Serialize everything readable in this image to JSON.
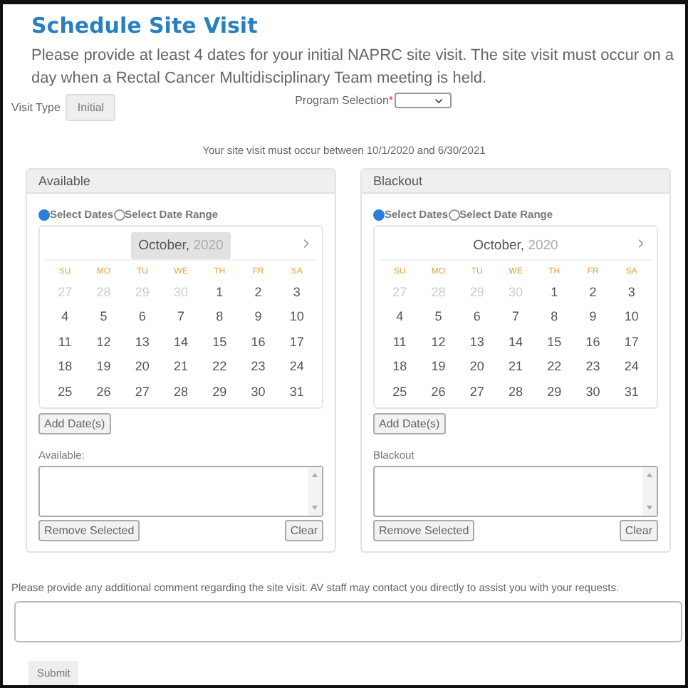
{
  "title": "Schedule Site Visit",
  "intro": "Please provide at least 4 dates for your initial NAPRC site visit. The site visit must occur on a day when a Rectal Cancer Multidisciplinary Team meeting is held.",
  "visit_type": {
    "label": "Visit Type",
    "value": "Initial"
  },
  "program_selection": {
    "label": "Program Selection",
    "required_mark": "*"
  },
  "notice": "Your site visit must occur between 10/1/2020 and 6/30/2021",
  "panels": [
    {
      "title": "Available",
      "modes": [
        {
          "label": "Select Dates",
          "selected": true
        },
        {
          "label": "Select Date Range",
          "selected": false
        }
      ],
      "calendar": {
        "month": "October,",
        "year": "2020",
        "month_highlighted": true,
        "weekdays": [
          "SU",
          "MO",
          "TU",
          "WE",
          "TH",
          "FR",
          "SA"
        ],
        "leading_days": [
          "27",
          "28",
          "29",
          "30"
        ],
        "days": [
          "1",
          "2",
          "3",
          "4",
          "5",
          "6",
          "7",
          "8",
          "9",
          "10",
          "11",
          "12",
          "13",
          "14",
          "15",
          "16",
          "17",
          "18",
          "19",
          "20",
          "21",
          "22",
          "23",
          "24",
          "25",
          "26",
          "27",
          "28",
          "29",
          "30",
          "31"
        ]
      },
      "add_button": "Add Date(s)",
      "list_label": "Available:",
      "remove_button": "Remove Selected",
      "clear_button": "Clear"
    },
    {
      "title": "Blackout",
      "modes": [
        {
          "label": "Select Dates",
          "selected": true
        },
        {
          "label": "Select Date Range",
          "selected": false
        }
      ],
      "calendar": {
        "month": "October,",
        "year": "2020",
        "month_highlighted": false,
        "weekdays": [
          "SU",
          "MO",
          "TU",
          "WE",
          "TH",
          "FR",
          "SA"
        ],
        "leading_days": [
          "27",
          "28",
          "29",
          "30"
        ],
        "days": [
          "1",
          "2",
          "3",
          "4",
          "5",
          "6",
          "7",
          "8",
          "9",
          "10",
          "11",
          "12",
          "13",
          "14",
          "15",
          "16",
          "17",
          "18",
          "19",
          "20",
          "21",
          "22",
          "23",
          "24",
          "25",
          "26",
          "27",
          "28",
          "29",
          "30",
          "31"
        ]
      },
      "add_button": "Add Date(s)",
      "list_label": "Blackout",
      "remove_button": "Remove Selected",
      "clear_button": "Clear"
    }
  ],
  "comment": {
    "label": "Please provide any additional comment regarding the site visit. AV staff may contact you directly to assist you with your requests."
  },
  "submit": "Submit"
}
